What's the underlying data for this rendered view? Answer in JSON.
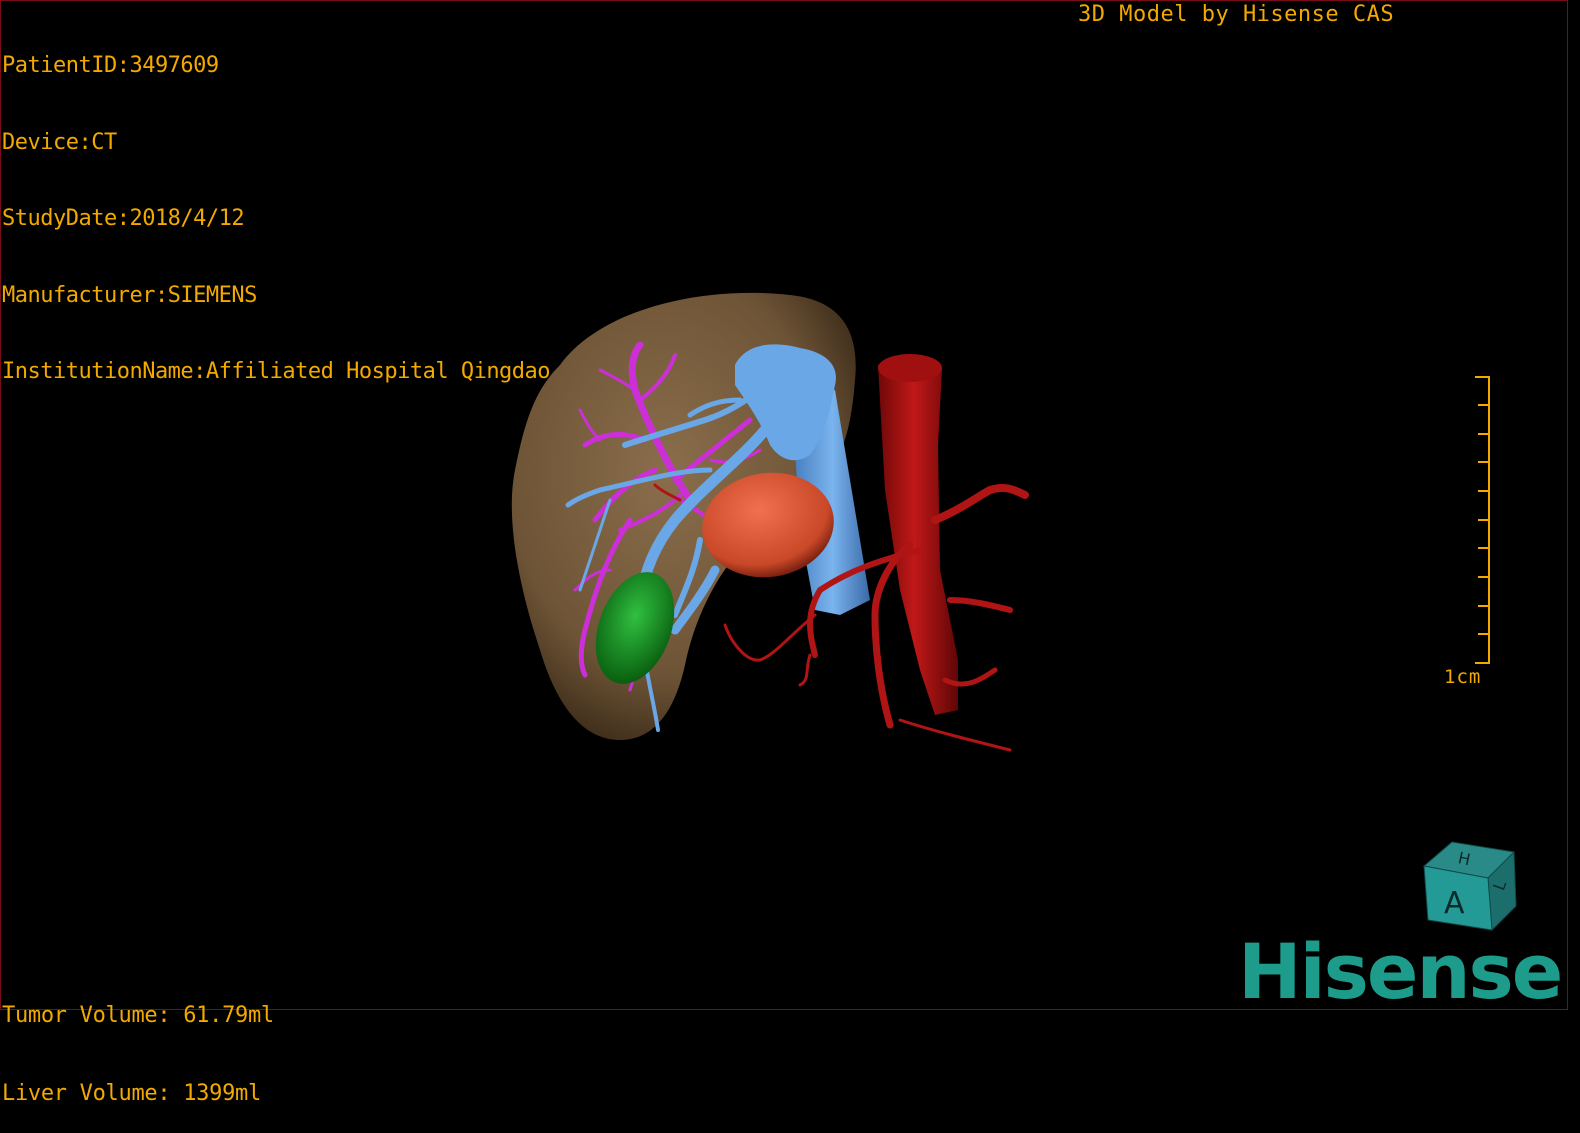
{
  "app": {
    "title": "3D Model by Hisense CAS",
    "brand_logo": "Hisense"
  },
  "patient_info": {
    "patient_id": "PatientID:3497609",
    "device": "Device:CT",
    "study_date": "StudyDate:2018/4/12",
    "manufacturer": "Manufacturer:SIEMENS",
    "institution": "InstitutionName:Affiliated Hospital Qingdao University-C"
  },
  "measurements": {
    "tumor_volume": "Tumor Volume: 61.79ml",
    "liver_volume": "Liver Volume: 1399ml"
  },
  "scale_bar": {
    "label": "1cm"
  },
  "orientation_cube": {
    "front_face": "A",
    "top_face": "H",
    "side_face": "L"
  },
  "model_structures": [
    {
      "name": "liver",
      "color": "#7a6040"
    },
    {
      "name": "portal-vein",
      "color": "#6aa7e6"
    },
    {
      "name": "hepatic-vein",
      "color": "#cc2fd8"
    },
    {
      "name": "tumor",
      "color": "#e06040"
    },
    {
      "name": "gallbladder",
      "color": "#18a030"
    },
    {
      "name": "aorta",
      "color": "#b01010"
    }
  ],
  "colors": {
    "overlay_text": "#f2a900",
    "brand": "#1d9c8c",
    "frame": "#7a0d1a",
    "background": "#000000"
  }
}
